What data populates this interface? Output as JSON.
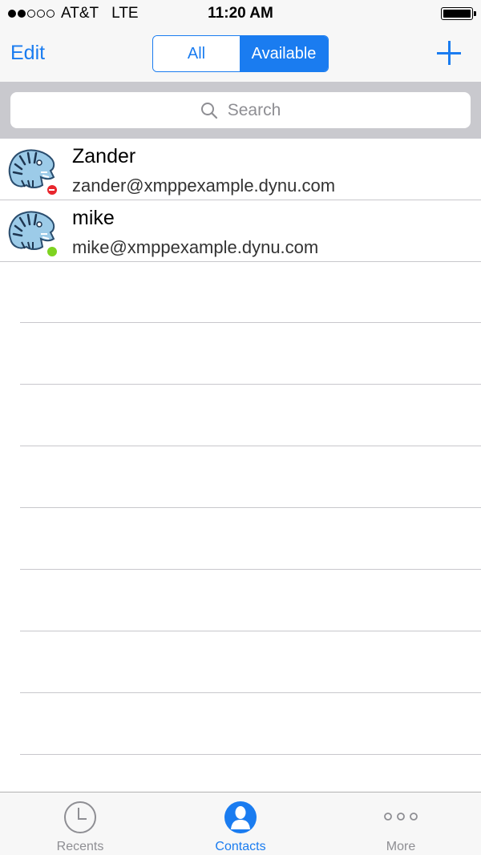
{
  "status_bar": {
    "carrier": "AT&T",
    "network": "LTE",
    "time": "11:20 AM",
    "signal_bars_filled": 2,
    "signal_bars_total": 5
  },
  "nav": {
    "edit_label": "Edit",
    "segments": [
      "All",
      "Available"
    ],
    "selected_segment": "Available",
    "add_icon": "plus-icon"
  },
  "search": {
    "placeholder": "Search",
    "icon": "magnifier-icon"
  },
  "contacts": [
    {
      "name": "Zander",
      "jid": "zander@xmppexample.dynu.com",
      "presence": "busy"
    },
    {
      "name": "mike",
      "jid": "mike@xmppexample.dynu.com",
      "presence": "online"
    }
  ],
  "tabs": [
    {
      "label": "Recents",
      "icon": "clock-icon",
      "active": false
    },
    {
      "label": "Contacts",
      "icon": "person-icon",
      "active": true
    },
    {
      "label": "More",
      "icon": "ellipsis-icon",
      "active": false
    }
  ],
  "colors": {
    "accent": "#1a7cf0",
    "busy": "#e8262d",
    "online": "#7ed321",
    "inactive_tab": "#8e8e93"
  }
}
